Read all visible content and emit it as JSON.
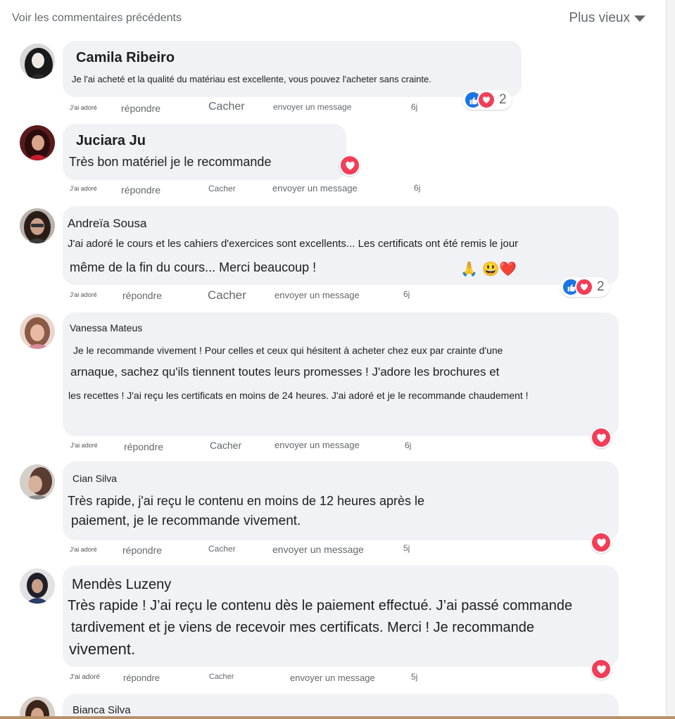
{
  "header": {
    "prev_comments": "Voir les commentaires précédents",
    "sort_label": "Plus vieux"
  },
  "actions": {
    "adore": "J'ai adoré",
    "reply": "répondre",
    "hide": "Cacher",
    "message": "envoyer un message"
  },
  "colors": {
    "bubble": "#f0f2f5",
    "like": "#1b74e4",
    "love": "#f33e58",
    "muted": "#65676b"
  },
  "comments": [
    {
      "name": "Camila Ribeiro",
      "lines": [
        "Je l'ai acheté et la qualité du matériau est excellente, vous pouvez l'acheter sans crainte."
      ],
      "time": "6j",
      "reactions": [
        "like",
        "love"
      ],
      "count": "2"
    },
    {
      "name": "Juciara Ju",
      "lines": [
        "Très bon matériel je le recommande"
      ],
      "time": "6j",
      "reactions": [
        "love"
      ]
    },
    {
      "name": "Andreïa Sousa",
      "lines": [
        "J'ai adoré le cours et les cahiers d'exercices sont excellents... Les certificats ont été remis le jour",
        "même de la fin du cours... Merci beaucoup !"
      ],
      "emojis": "🙏 😃❤️",
      "time": "6j",
      "reactions": [
        "like",
        "love"
      ],
      "count": "2"
    },
    {
      "name": "Vanessa Mateus",
      "lines": [
        "Je le recommande vivement ! Pour celles et ceux qui hésitent à acheter chez eux par crainte d'une",
        "arnaque, sachez qu'ils tiennent toutes leurs promesses ! J'adore les brochures et",
        "les recettes ! J'ai reçu les certificats en moins de 24 heures. J'ai adoré et je le recommande chaudement !"
      ],
      "time": "6j",
      "reactions": [
        "love"
      ]
    },
    {
      "name": "Cian Silva",
      "lines": [
        "Très rapide, j'ai reçu le contenu en moins de 12 heures après le",
        "paiement, je le recommande vivement."
      ],
      "time": "5j",
      "reactions": [
        "love"
      ]
    },
    {
      "name": "Mendès Luzeny",
      "lines": [
        "Très rapide ! J’ai reçu le contenu dès le paiement effectué. J’ai passé commande",
        "tardivement et je viens de recevoir mes certificats. Merci ! Je recommande",
        "vivement."
      ],
      "time": "5j",
      "reactions": [
        "love"
      ]
    },
    {
      "name": "Bianca Silva",
      "lines": []
    }
  ]
}
